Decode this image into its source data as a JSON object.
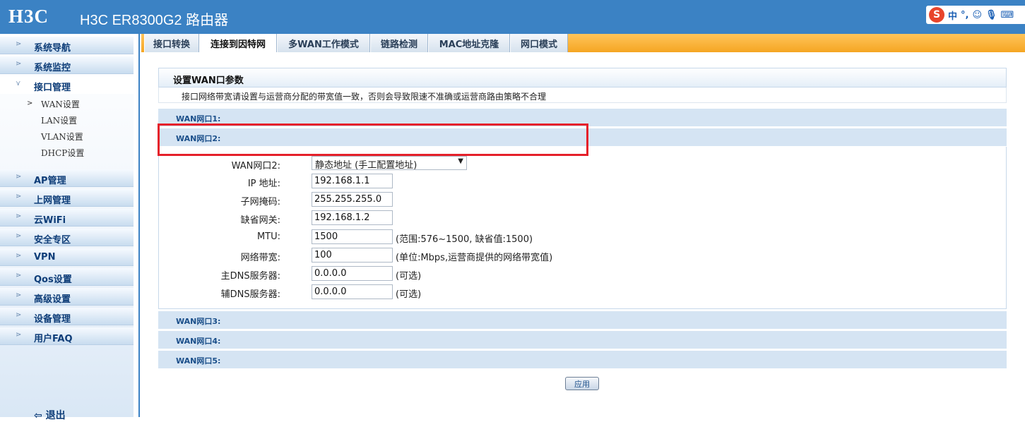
{
  "header": {
    "logo": "H3C",
    "title": "H3C ER8300G2 路由器",
    "ime": {
      "logo": "S",
      "mode": "中",
      "punct": "°,",
      "icons": [
        "smiley-icon",
        "microphone-icon",
        "keyboard-icon"
      ]
    }
  },
  "sidebar": {
    "items": [
      {
        "label": "系统导航"
      },
      {
        "label": "系统监控"
      },
      {
        "label": "接口管理"
      },
      {
        "label": "AP管理"
      },
      {
        "label": "上网管理"
      },
      {
        "label": "云WiFi"
      },
      {
        "label": "安全专区"
      },
      {
        "label": "VPN"
      },
      {
        "label": "Qos设置"
      },
      {
        "label": "高级设置"
      },
      {
        "label": "设备管理"
      },
      {
        "label": "用户FAQ"
      }
    ],
    "subitems": [
      {
        "label": "WAN设置"
      },
      {
        "label": "LAN设置"
      },
      {
        "label": "VLAN设置"
      },
      {
        "label": "DHCP设置"
      }
    ],
    "logout": "退出"
  },
  "tabs": [
    {
      "label": "接口转换"
    },
    {
      "label": "连接到因特网"
    },
    {
      "label": "多WAN工作模式"
    },
    {
      "label": "链路检测"
    },
    {
      "label": "MAC地址克隆"
    },
    {
      "label": "网口模式"
    }
  ],
  "panel": {
    "title": "设置WAN口参数",
    "notice": "接口网络带宽请设置与运营商分配的带宽值一致，否则会导致限速不准确或运营商路由策略不合理",
    "wan": [
      "WAN网口1:",
      "WAN网口2:",
      "WAN网口3:",
      "WAN网口4:",
      "WAN网口5:"
    ]
  },
  "form": {
    "mode_label": "WAN网口2:",
    "mode_value": "静态地址 (手工配置地址)",
    "ip_label": "IP 地址:",
    "ip_value": "192.168.1.1",
    "mask_label": "子网掩码:",
    "mask_value": "255.255.255.0",
    "gw_label": "缺省网关:",
    "gw_value": "192.168.1.2",
    "mtu_label": "MTU:",
    "mtu_value": "1500",
    "mtu_hint": "(范围:576~1500, 缺省值:1500)",
    "bw_label": "网络带宽:",
    "bw_value": "100",
    "bw_hint": "(单位:Mbps,运营商提供的网络带宽值)",
    "dns1_label": "主DNS服务器:",
    "dns1_value": "0.0.0.0",
    "dns1_hint": "(可选)",
    "dns2_label": "辅DNS服务器:",
    "dns2_value": "0.0.0.0",
    "dns2_hint": "(可选)"
  },
  "apply_label": "应用",
  "colors": {
    "header": "#3b82c4",
    "tabbar": "#f5a623",
    "highlight": "#e5202a",
    "wan_bar": "#d5e4f3"
  }
}
